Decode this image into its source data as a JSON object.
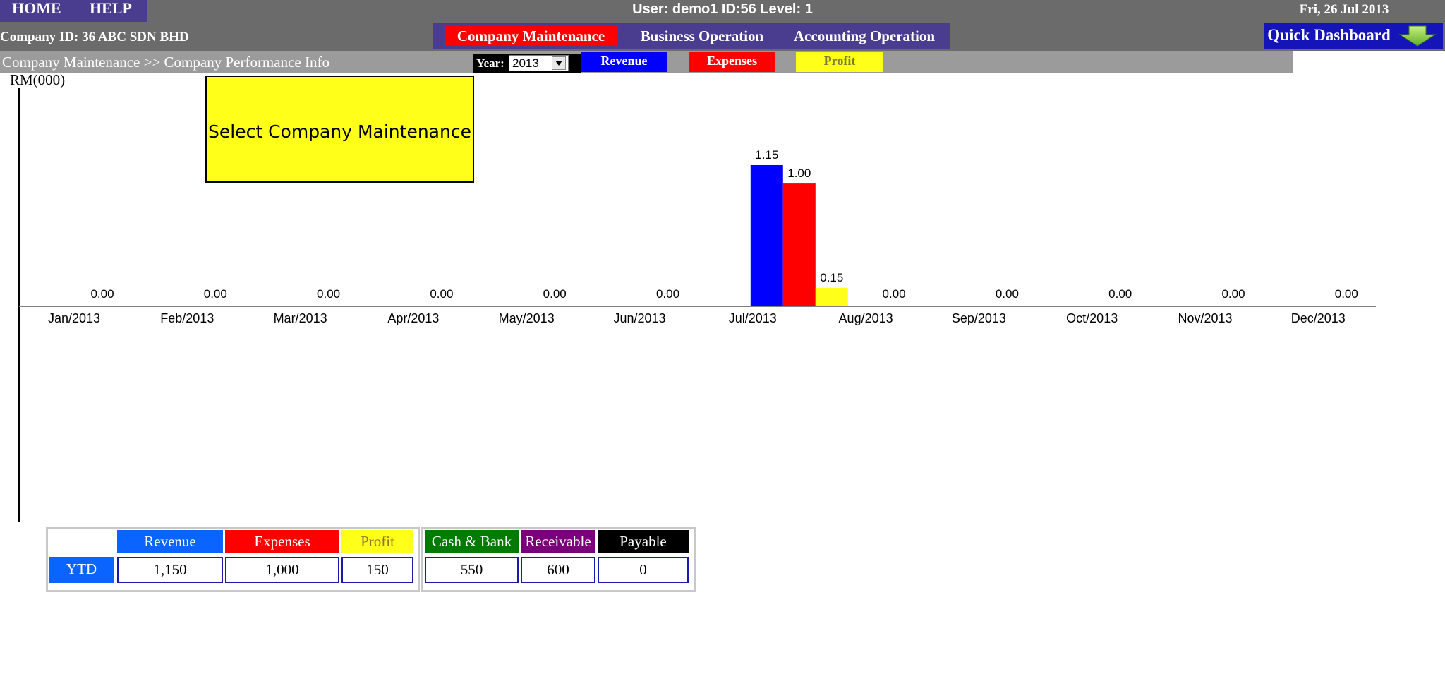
{
  "topbar": {
    "home_label": "HOME",
    "help_label": "HELP",
    "user_info": "User: demo1 ID:56 Level: 1",
    "date": "Fri, 26 Jul 2013"
  },
  "company": {
    "id_text": "Company ID: 36 ABC SDN BHD"
  },
  "nav": {
    "items": [
      {
        "label": "Company Maintenance",
        "active": true
      },
      {
        "label": "Business Operation",
        "active": false
      },
      {
        "label": "Accounting Operation",
        "active": false
      }
    ],
    "quick_dashboard_label": "Quick Dashboard",
    "quick_dashboard_icon": "down-arrow-icon"
  },
  "breadcrumb": "Company Maintenance >> Company Performance Info",
  "year_filter": {
    "label": "Year:",
    "selected": "2013"
  },
  "legend": [
    {
      "label": "Revenue",
      "color": "#0000ff"
    },
    {
      "label": "Expenses",
      "color": "#ff0000"
    },
    {
      "label": "Profit",
      "color": "#ffff1a"
    }
  ],
  "callout": {
    "text": "Select Company Maintenance"
  },
  "chart_data": {
    "type": "bar",
    "ylabel": "RM(000)",
    "categories": [
      "Jan/2013",
      "Feb/2013",
      "Mar/2013",
      "Apr/2013",
      "May/2013",
      "Jun/2013",
      "Jul/2013",
      "Aug/2013",
      "Sep/2013",
      "Oct/2013",
      "Nov/2013",
      "Dec/2013"
    ],
    "series": [
      {
        "name": "Revenue",
        "color": "#0000ff",
        "values": [
          0,
          0,
          0,
          0,
          0,
          0,
          1.15,
          0,
          0,
          0,
          0,
          0
        ]
      },
      {
        "name": "Expenses",
        "color": "#ff0000",
        "values": [
          0,
          0,
          0,
          0,
          0,
          0,
          1.0,
          0,
          0,
          0,
          0,
          0
        ]
      },
      {
        "name": "Profit",
        "color": "#ffff1a",
        "values": [
          0,
          0,
          0,
          0,
          0,
          0,
          0.15,
          0,
          0,
          0,
          0,
          0
        ]
      }
    ],
    "data_labels": [
      "0.00",
      "0.00",
      "0.00",
      "0.00",
      "0.00",
      "0.00",
      "",
      "0.00",
      "0.00",
      "0.00",
      "0.00",
      "0.00"
    ],
    "jul_labels": [
      "1.15",
      "1.00",
      "0.15"
    ],
    "ylim": [
      0,
      1.15
    ],
    "grid": false
  },
  "summary": {
    "row_label": "YTD",
    "table1": {
      "headers": [
        {
          "label": "Revenue",
          "color": "#0a64ff"
        },
        {
          "label": "Expenses",
          "color": "#ff0000"
        },
        {
          "label": "Profit",
          "color": "#ffff1a"
        }
      ],
      "values": [
        "1,150",
        "1,000",
        "150"
      ]
    },
    "table2": {
      "headers": [
        {
          "label": "Cash & Bank",
          "color": "#007a00"
        },
        {
          "label": "Receivable",
          "color": "#7a007a"
        },
        {
          "label": "Payable",
          "color": "#000000"
        }
      ],
      "values": [
        "550",
        "600",
        "0"
      ]
    }
  }
}
